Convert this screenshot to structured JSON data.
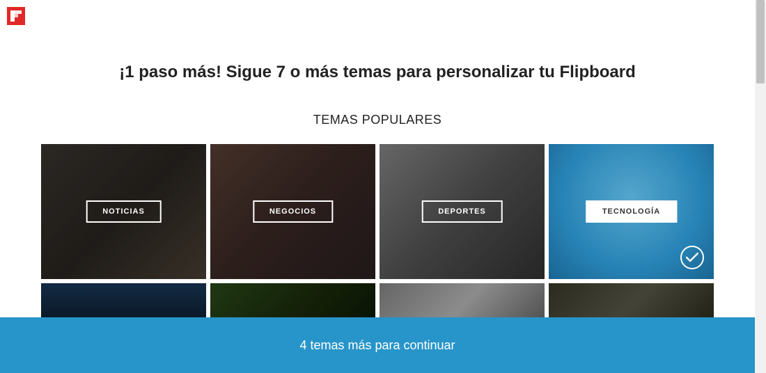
{
  "header": {
    "logo_name": "flipboard-logo"
  },
  "main": {
    "title": "¡1 paso más! Sigue 7 o más temas para personalizar tu Flipboard",
    "subtitle": "TEMAS POPULARES"
  },
  "topics": [
    {
      "label": "NOTICIAS",
      "selected": false
    },
    {
      "label": "NEGOCIOS",
      "selected": false
    },
    {
      "label": "DEPORTES",
      "selected": false
    },
    {
      "label": "TECNOLOGÍA",
      "selected": true
    }
  ],
  "footer": {
    "message": "4 temas más para continuar"
  },
  "colors": {
    "brand_red": "#e12828",
    "accent_blue": "#2795c9"
  }
}
